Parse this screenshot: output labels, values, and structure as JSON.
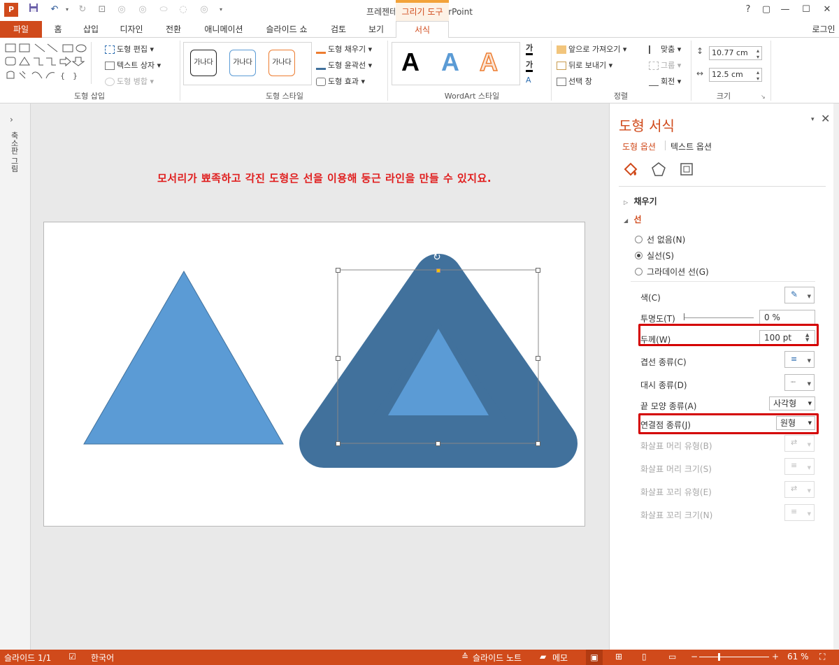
{
  "titlebar": {
    "title": "프레젠테이션1 - PowerPoint",
    "contextual_tab": "그리기 도구",
    "help": "?",
    "restore": "▢",
    "minimize": "—",
    "maximize": "☐",
    "close": "✕"
  },
  "tabs": [
    {
      "label": "파일"
    },
    {
      "label": "홈"
    },
    {
      "label": "삽입"
    },
    {
      "label": "디자인"
    },
    {
      "label": "전환"
    },
    {
      "label": "애니메이션"
    },
    {
      "label": "슬라이드 쇼"
    },
    {
      "label": "검토"
    },
    {
      "label": "보기"
    },
    {
      "label": "서식"
    }
  ],
  "login": "로그인",
  "ribbon": {
    "insert_shapes": {
      "label": "도형 삽입",
      "edit_shape": "도형 편집",
      "text_box": "텍스트 상자",
      "merge_shapes": "도형 병합"
    },
    "shape_styles": {
      "label": "도형 스타일",
      "preset1": "가나다",
      "preset2": "가나다",
      "preset3": "가나다",
      "fill": "도형 채우기",
      "outline": "도형 윤곽선",
      "effects": "도형 효과"
    },
    "wordart": {
      "label": "WordArt 스타일",
      "sample": "A",
      "text_fill": "가",
      "text_outline": "가"
    },
    "arrange": {
      "label": "정렬",
      "bring_forward": "앞으로 가져오기",
      "send_backward": "뒤로 보내기",
      "selection_pane": "선택 창",
      "align": "맞춤",
      "group": "그룹",
      "rotate": "회전"
    },
    "size": {
      "label": "크기",
      "height": "10.77 cm",
      "width": "12.5 cm"
    }
  },
  "thumbnails_label": "축소판 그림",
  "slide": {
    "headline": "모서리가 뾰족하고 각진 도형은 선을 이용해 둥근 라인을 만들 수 있지요."
  },
  "pane": {
    "title": "도형 서식",
    "tab_shape": "도형 옵션",
    "tab_text": "텍스트 옵션",
    "fill_section": "채우기",
    "line_section": "선",
    "line_options": [
      {
        "label": "선 없음(N)",
        "selected": false
      },
      {
        "label": "실선(S)",
        "selected": true
      },
      {
        "label": "그라데이션 선(G)",
        "selected": false
      }
    ],
    "color": "색(C)",
    "transparency": "투명도(T)",
    "transparency_value": "0 %",
    "width": "두께(W)",
    "width_value": "100 pt",
    "compound_type": "겹선 종류(C)",
    "dash_type": "대시 종류(D)",
    "cap_type": "끝 모양 종류(A)",
    "cap_value": "사각형",
    "join_type": "연결점 종류(J)",
    "join_value": "원형",
    "begin_arrow_type": "화살표 머리 유형(B)",
    "begin_arrow_size": "화살표 머리 크기(S)",
    "end_arrow_type": "화살표 꼬리 유형(E)",
    "end_arrow_size": "화살표 꼬리 크기(N)"
  },
  "status": {
    "slide": "슬라이드 1/1",
    "language": "한국어",
    "notes": "슬라이드 노트",
    "comments": "메모",
    "zoom": "61 %"
  },
  "colors": {
    "accent": "#d04a1b",
    "shape_fill": "#5b9bd5",
    "outline_dark": "#41719c",
    "highlight": "#d40000"
  }
}
